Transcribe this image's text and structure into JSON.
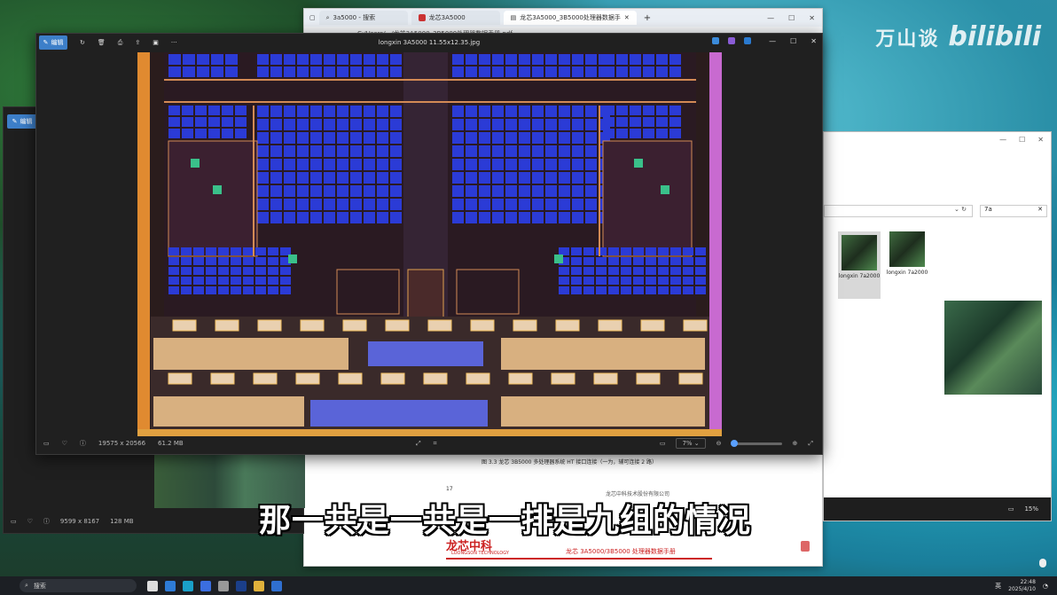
{
  "watermark": {
    "text1": "万山谈",
    "text2": "bilibili"
  },
  "browser": {
    "tabs": [
      {
        "label": "3a5000 - 搜索"
      },
      {
        "label": "龙芯3A5000"
      },
      {
        "label": "龙芯3A5000_3B5000处理器数据手"
      }
    ],
    "address": "C:/Users/.../龙芯3A5000_3B5000处理器数据手册.pdf",
    "pdf": {
      "caption": "图 3.3  龙芯 3B5000 多处理器系统 HT 接口连接（一为，辅可连接 2 路）",
      "page_number": "17",
      "company": "龙芯中科技术股份有限公司",
      "logo_cn": "龙芯中科",
      "logo_en": "LOONGSON TECHNOLOGY",
      "footer_title": "龙芯 3A5000/3B5000 处理器数据手册"
    }
  },
  "viewer2": {
    "edit_label": "编辑",
    "dims": "9599 x 8167",
    "size": "128 MB"
  },
  "explorer": {
    "search": "7a",
    "items": [
      {
        "label": "longxin 7a2000"
      },
      {
        "label": "longxin 7a2000"
      }
    ],
    "zoom": "15%"
  },
  "viewer": {
    "edit_label": "编辑",
    "title": "longxin 3A5000 11.55x12.35.jpg",
    "dims": "19575 x 20566",
    "size": "61.2 MB",
    "zoom": "7%",
    "zoom_fraction": 0.04
  },
  "subtitle": "那一共是一共是一排是九组的情况",
  "taskbar": {
    "search": "搜索",
    "lang": "英",
    "time": "22:48",
    "date": "2025/4/10"
  },
  "colors": {
    "accent": "#3d7fc9",
    "die_blue": "#2b3bd6",
    "die_bg": "#2a1a22"
  }
}
